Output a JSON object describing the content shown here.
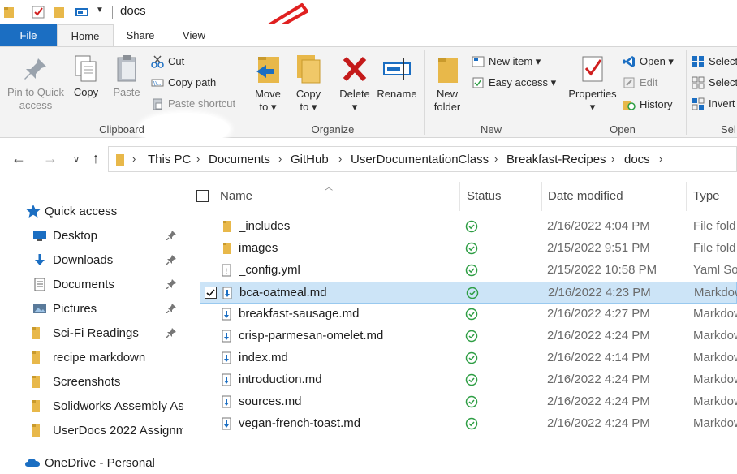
{
  "window": {
    "title": "docs"
  },
  "tabs": {
    "file": "File",
    "home": "Home",
    "share": "Share",
    "view": "View"
  },
  "ribbon": {
    "clipboard": {
      "pin_label_1": "Pin to Quick",
      "pin_label_2": "access",
      "copy": "Copy",
      "paste": "Paste",
      "cut": "Cut",
      "copy_path": "Copy path",
      "paste_shortcut": "Paste shortcut",
      "group": "Clipboard"
    },
    "organize": {
      "move_to_1": "Move",
      "move_to_2": "to",
      "copy_to_1": "Copy",
      "copy_to_2": "to",
      "delete": "Delete",
      "rename": "Rename",
      "group": "Organize"
    },
    "new": {
      "new_folder_1": "New",
      "new_folder_2": "folder",
      "new_item": "New item",
      "easy_access": "Easy access",
      "group": "New"
    },
    "open": {
      "properties": "Properties",
      "open": "Open",
      "edit": "Edit",
      "history": "History",
      "group": "Open"
    },
    "select": {
      "select_all": "Select",
      "select_none": "Select",
      "invert": "Invert",
      "group": "Sel"
    }
  },
  "address": {
    "crumbs": [
      "This PC",
      "Documents",
      "GitHub",
      "UserDocumentationClass",
      "Breakfast-Recipes",
      "docs"
    ]
  },
  "nav": {
    "quick_access": "Quick access",
    "items": [
      {
        "label": "Desktop",
        "icon": "desktop-icon",
        "pinned": true
      },
      {
        "label": "Downloads",
        "icon": "downloads-icon",
        "pinned": true
      },
      {
        "label": "Documents",
        "icon": "documents-icon",
        "pinned": true
      },
      {
        "label": "Pictures",
        "icon": "pictures-icon",
        "pinned": true
      },
      {
        "label": "Sci-Fi Readings",
        "icon": "folder-icon",
        "pinned": true
      },
      {
        "label": "recipe markdown",
        "icon": "folder-icon",
        "pinned": false
      },
      {
        "label": "Screenshots",
        "icon": "folder-icon",
        "pinned": false
      },
      {
        "label": "Solidworks Assembly As",
        "icon": "folder-icon",
        "pinned": false
      },
      {
        "label": "UserDocs 2022 Assignm",
        "icon": "folder-icon",
        "pinned": false
      }
    ],
    "onedrive": "OneDrive - Personal"
  },
  "columns": {
    "name": "Name",
    "status": "Status",
    "date": "Date modified",
    "type": "Type"
  },
  "files": [
    {
      "name": "_includes",
      "date": "2/16/2022 4:04 PM",
      "type": "File fold",
      "kind": "folder",
      "selected": false
    },
    {
      "name": "images",
      "date": "2/15/2022 9:51 PM",
      "type": "File fold",
      "kind": "folder",
      "selected": false
    },
    {
      "name": "_config.yml",
      "date": "2/15/2022 10:58 PM",
      "type": "Yaml So",
      "kind": "yml",
      "selected": false
    },
    {
      "name": "bca-oatmeal.md",
      "date": "2/16/2022 4:23 PM",
      "type": "Markdow",
      "kind": "md",
      "selected": true
    },
    {
      "name": "breakfast-sausage.md",
      "date": "2/16/2022 4:27 PM",
      "type": "Markdow",
      "kind": "md",
      "selected": false
    },
    {
      "name": "crisp-parmesan-omelet.md",
      "date": "2/16/2022 4:24 PM",
      "type": "Markdow",
      "kind": "md",
      "selected": false
    },
    {
      "name": "index.md",
      "date": "2/16/2022 4:14 PM",
      "type": "Markdow",
      "kind": "md",
      "selected": false
    },
    {
      "name": "introduction.md",
      "date": "2/16/2022 4:24 PM",
      "type": "Markdow",
      "kind": "md",
      "selected": false
    },
    {
      "name": "sources.md",
      "date": "2/16/2022 4:24 PM",
      "type": "Markdow",
      "kind": "md",
      "selected": false
    },
    {
      "name": "vegan-french-toast.md",
      "date": "2/16/2022 4:24 PM",
      "type": "Markdow",
      "kind": "md",
      "selected": false
    }
  ],
  "colors": {
    "accent": "#1b6ec2",
    "folder": "#e8b84a",
    "status_ok": "#2e9e44",
    "annotation": "#e02020",
    "selection": "#cce4f7"
  }
}
